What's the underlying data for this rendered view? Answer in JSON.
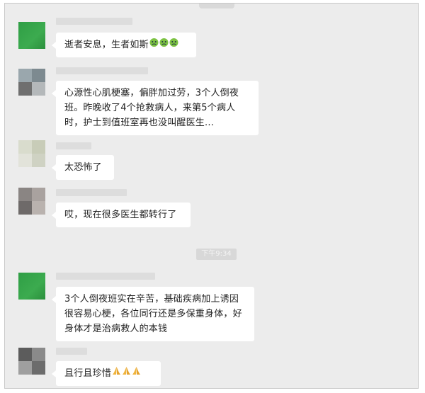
{
  "messages": [
    {
      "text": "逝者安息，生者如斯",
      "emoji": [
        "sick-face",
        "sick-face",
        "sick-face"
      ]
    },
    {
      "text": "心源性心肌梗塞，偏胖加过劳，3个人倒夜班。昨晚收了4个抢救病人，来第5个病人时，护士到值班室再也没叫醒医生..."
    },
    {
      "text": "太恐怖了"
    },
    {
      "text": "哎，现在很多医生都转行了"
    },
    {
      "text": "3个人倒夜班实在辛苦，基础疾病加上诱因很容易心梗，各位同行还是多保重身体，好身体才是治病救人的本钱"
    },
    {
      "text": "且行且珍惜",
      "emoji": [
        "pray",
        "pray",
        "pray"
      ]
    }
  ],
  "timestamp": "下午9:34",
  "colors": {
    "chat_bg": "#ececec",
    "bubble_bg": "#ffffff",
    "avatar_green": "#2f9e45"
  }
}
